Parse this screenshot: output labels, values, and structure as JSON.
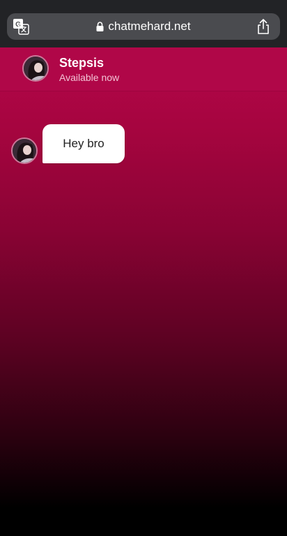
{
  "browser": {
    "url": "chatmehard.net",
    "translate_icon": "translate-icon",
    "lock_icon": "lock-icon",
    "share_icon": "share-icon"
  },
  "chat": {
    "contact": {
      "name": "Stepsis",
      "status": "Available now"
    },
    "messages": [
      {
        "sender": "Stepsis",
        "text": "Hey bro"
      }
    ]
  },
  "colors": {
    "header": "#b00748",
    "gradient_top": "#b5064a",
    "gradient_bottom": "#000000",
    "bubble": "#ffffff"
  }
}
